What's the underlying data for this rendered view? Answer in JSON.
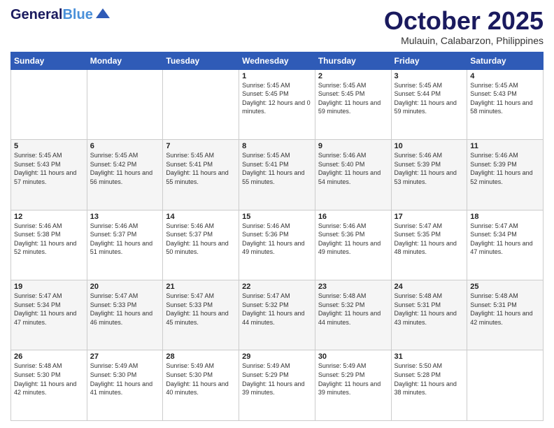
{
  "header": {
    "logo_general": "General",
    "logo_blue": "Blue",
    "month_title": "October 2025",
    "location": "Mulauin, Calabarzon, Philippines"
  },
  "days_of_week": [
    "Sunday",
    "Monday",
    "Tuesday",
    "Wednesday",
    "Thursday",
    "Friday",
    "Saturday"
  ],
  "weeks": [
    [
      {
        "day": "",
        "sunrise": "",
        "sunset": "",
        "daylight": ""
      },
      {
        "day": "",
        "sunrise": "",
        "sunset": "",
        "daylight": ""
      },
      {
        "day": "",
        "sunrise": "",
        "sunset": "",
        "daylight": ""
      },
      {
        "day": "1",
        "sunrise": "Sunrise: 5:45 AM",
        "sunset": "Sunset: 5:45 PM",
        "daylight": "Daylight: 12 hours and 0 minutes."
      },
      {
        "day": "2",
        "sunrise": "Sunrise: 5:45 AM",
        "sunset": "Sunset: 5:45 PM",
        "daylight": "Daylight: 11 hours and 59 minutes."
      },
      {
        "day": "3",
        "sunrise": "Sunrise: 5:45 AM",
        "sunset": "Sunset: 5:44 PM",
        "daylight": "Daylight: 11 hours and 59 minutes."
      },
      {
        "day": "4",
        "sunrise": "Sunrise: 5:45 AM",
        "sunset": "Sunset: 5:43 PM",
        "daylight": "Daylight: 11 hours and 58 minutes."
      }
    ],
    [
      {
        "day": "5",
        "sunrise": "Sunrise: 5:45 AM",
        "sunset": "Sunset: 5:43 PM",
        "daylight": "Daylight: 11 hours and 57 minutes."
      },
      {
        "day": "6",
        "sunrise": "Sunrise: 5:45 AM",
        "sunset": "Sunset: 5:42 PM",
        "daylight": "Daylight: 11 hours and 56 minutes."
      },
      {
        "day": "7",
        "sunrise": "Sunrise: 5:45 AM",
        "sunset": "Sunset: 5:41 PM",
        "daylight": "Daylight: 11 hours and 55 minutes."
      },
      {
        "day": "8",
        "sunrise": "Sunrise: 5:45 AM",
        "sunset": "Sunset: 5:41 PM",
        "daylight": "Daylight: 11 hours and 55 minutes."
      },
      {
        "day": "9",
        "sunrise": "Sunrise: 5:46 AM",
        "sunset": "Sunset: 5:40 PM",
        "daylight": "Daylight: 11 hours and 54 minutes."
      },
      {
        "day": "10",
        "sunrise": "Sunrise: 5:46 AM",
        "sunset": "Sunset: 5:39 PM",
        "daylight": "Daylight: 11 hours and 53 minutes."
      },
      {
        "day": "11",
        "sunrise": "Sunrise: 5:46 AM",
        "sunset": "Sunset: 5:39 PM",
        "daylight": "Daylight: 11 hours and 52 minutes."
      }
    ],
    [
      {
        "day": "12",
        "sunrise": "Sunrise: 5:46 AM",
        "sunset": "Sunset: 5:38 PM",
        "daylight": "Daylight: 11 hours and 52 minutes."
      },
      {
        "day": "13",
        "sunrise": "Sunrise: 5:46 AM",
        "sunset": "Sunset: 5:37 PM",
        "daylight": "Daylight: 11 hours and 51 minutes."
      },
      {
        "day": "14",
        "sunrise": "Sunrise: 5:46 AM",
        "sunset": "Sunset: 5:37 PM",
        "daylight": "Daylight: 11 hours and 50 minutes."
      },
      {
        "day": "15",
        "sunrise": "Sunrise: 5:46 AM",
        "sunset": "Sunset: 5:36 PM",
        "daylight": "Daylight: 11 hours and 49 minutes."
      },
      {
        "day": "16",
        "sunrise": "Sunrise: 5:46 AM",
        "sunset": "Sunset: 5:36 PM",
        "daylight": "Daylight: 11 hours and 49 minutes."
      },
      {
        "day": "17",
        "sunrise": "Sunrise: 5:47 AM",
        "sunset": "Sunset: 5:35 PM",
        "daylight": "Daylight: 11 hours and 48 minutes."
      },
      {
        "day": "18",
        "sunrise": "Sunrise: 5:47 AM",
        "sunset": "Sunset: 5:34 PM",
        "daylight": "Daylight: 11 hours and 47 minutes."
      }
    ],
    [
      {
        "day": "19",
        "sunrise": "Sunrise: 5:47 AM",
        "sunset": "Sunset: 5:34 PM",
        "daylight": "Daylight: 11 hours and 47 minutes."
      },
      {
        "day": "20",
        "sunrise": "Sunrise: 5:47 AM",
        "sunset": "Sunset: 5:33 PM",
        "daylight": "Daylight: 11 hours and 46 minutes."
      },
      {
        "day": "21",
        "sunrise": "Sunrise: 5:47 AM",
        "sunset": "Sunset: 5:33 PM",
        "daylight": "Daylight: 11 hours and 45 minutes."
      },
      {
        "day": "22",
        "sunrise": "Sunrise: 5:47 AM",
        "sunset": "Sunset: 5:32 PM",
        "daylight": "Daylight: 11 hours and 44 minutes."
      },
      {
        "day": "23",
        "sunrise": "Sunrise: 5:48 AM",
        "sunset": "Sunset: 5:32 PM",
        "daylight": "Daylight: 11 hours and 44 minutes."
      },
      {
        "day": "24",
        "sunrise": "Sunrise: 5:48 AM",
        "sunset": "Sunset: 5:31 PM",
        "daylight": "Daylight: 11 hours and 43 minutes."
      },
      {
        "day": "25",
        "sunrise": "Sunrise: 5:48 AM",
        "sunset": "Sunset: 5:31 PM",
        "daylight": "Daylight: 11 hours and 42 minutes."
      }
    ],
    [
      {
        "day": "26",
        "sunrise": "Sunrise: 5:48 AM",
        "sunset": "Sunset: 5:30 PM",
        "daylight": "Daylight: 11 hours and 42 minutes."
      },
      {
        "day": "27",
        "sunrise": "Sunrise: 5:49 AM",
        "sunset": "Sunset: 5:30 PM",
        "daylight": "Daylight: 11 hours and 41 minutes."
      },
      {
        "day": "28",
        "sunrise": "Sunrise: 5:49 AM",
        "sunset": "Sunset: 5:30 PM",
        "daylight": "Daylight: 11 hours and 40 minutes."
      },
      {
        "day": "29",
        "sunrise": "Sunrise: 5:49 AM",
        "sunset": "Sunset: 5:29 PM",
        "daylight": "Daylight: 11 hours and 39 minutes."
      },
      {
        "day": "30",
        "sunrise": "Sunrise: 5:49 AM",
        "sunset": "Sunset: 5:29 PM",
        "daylight": "Daylight: 11 hours and 39 minutes."
      },
      {
        "day": "31",
        "sunrise": "Sunrise: 5:50 AM",
        "sunset": "Sunset: 5:28 PM",
        "daylight": "Daylight: 11 hours and 38 minutes."
      },
      {
        "day": "",
        "sunrise": "",
        "sunset": "",
        "daylight": ""
      }
    ]
  ]
}
